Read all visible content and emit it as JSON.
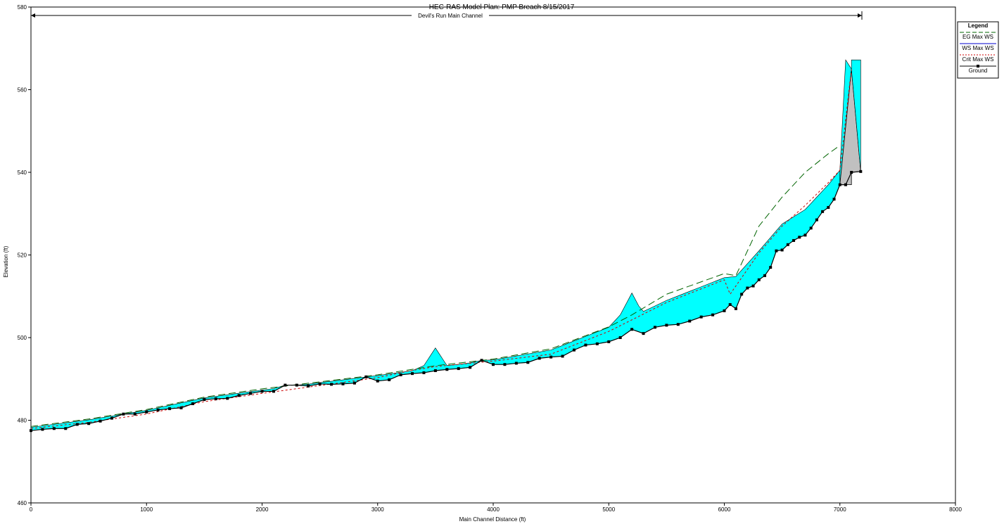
{
  "chart_data": {
    "type": "line",
    "title": "HEC-RAS Model      Plan: PMP Breach     8/15/2017",
    "reach_label": "Devil's Run Main Channel",
    "xlabel": "Main Channel Distance (ft)",
    "ylabel": "Elevation (ft)",
    "xlim": [
      0,
      8000
    ],
    "ylim": [
      460,
      580
    ],
    "x_ticks": [
      0,
      1000,
      2000,
      3000,
      4000,
      5000,
      6000,
      7000,
      8000
    ],
    "y_ticks": [
      460,
      480,
      500,
      520,
      540,
      560,
      580
    ],
    "grid": false,
    "legend_placement": "top-right",
    "legend_title": "Legend",
    "colors": {
      "eg": "#006400",
      "ws": "#0000cc",
      "crit": "#cc0000",
      "ground": "#000000",
      "water_fill": "#00ffff",
      "structure_fill": "#c0c0c0"
    },
    "series": [
      {
        "name": "EG  Max WS",
        "style": "dash",
        "x": [
          0,
          500,
          1000,
          1500,
          2000,
          2500,
          3000,
          3500,
          4000,
          4500,
          5000,
          5200,
          5500,
          6000,
          6100,
          6300,
          6500,
          6700,
          6900,
          7000
        ],
        "y": [
          478.5,
          480.3,
          482.6,
          485.6,
          487.6,
          489.3,
          491.0,
          493.2,
          494.8,
          497.3,
          502.6,
          505.5,
          510.5,
          515.5,
          515.0,
          527.0,
          534.0,
          540.0,
          544.5,
          546.5
        ]
      },
      {
        "name": "WS  Max WS",
        "style": "solid",
        "x": [
          0,
          500,
          1000,
          1500,
          2000,
          2500,
          3000,
          3500,
          4000,
          4500,
          5000,
          5200,
          5500,
          6000,
          6100,
          6300,
          6500,
          6700,
          6900,
          7000,
          7050,
          7100,
          7180
        ],
        "y": [
          478.3,
          480.1,
          482.4,
          485.4,
          487.3,
          489.1,
          490.8,
          492.8,
          494.6,
          497.0,
          502.5,
          505.0,
          509.0,
          514.5,
          514.8,
          521.0,
          527.5,
          531.0,
          537.0,
          540.5,
          567.2,
          567.2,
          567.2
        ]
      },
      {
        "name": "Crit  Max WS",
        "style": "dot",
        "x": [
          0,
          500,
          1000,
          1500,
          2000,
          2500,
          3000,
          3250,
          3500,
          4000,
          4500,
          5000,
          5500,
          6000,
          6050,
          6300,
          6500,
          6700,
          6900,
          7000,
          7100
        ],
        "y": [
          478.0,
          479.5,
          481.5,
          484.5,
          486.5,
          488.4,
          490.3,
          491.8,
          493.0,
          494.3,
          496.0,
          501.5,
          508.5,
          514.0,
          510.5,
          520.5,
          527.0,
          532.0,
          537.5,
          540.5,
          565.0
        ]
      },
      {
        "name": "Ground",
        "style": "solid-marker",
        "x": [
          0,
          100,
          200,
          300,
          400,
          500,
          600,
          700,
          800,
          900,
          1000,
          1100,
          1200,
          1300,
          1400,
          1500,
          1600,
          1700,
          1800,
          1900,
          2000,
          2100,
          2200,
          2300,
          2400,
          2500,
          2600,
          2700,
          2800,
          2900,
          3000,
          3100,
          3200,
          3300,
          3400,
          3500,
          3600,
          3700,
          3800,
          3900,
          4000,
          4100,
          4200,
          4300,
          4400,
          4500,
          4600,
          4700,
          4800,
          4900,
          5000,
          5100,
          5200,
          5300,
          5400,
          5500,
          5600,
          5700,
          5800,
          5900,
          6000,
          6050,
          6100,
          6150,
          6200,
          6250,
          6300,
          6350,
          6400,
          6450,
          6500,
          6550,
          6600,
          6650,
          6700,
          6750,
          6800,
          6850,
          6900,
          6950,
          7000,
          7050,
          7100,
          7180
        ],
        "y": [
          477.5,
          477.8,
          478.0,
          478.0,
          479.0,
          479.2,
          479.8,
          480.5,
          481.5,
          481.5,
          482.0,
          482.5,
          482.8,
          483.0,
          484.0,
          485.0,
          485.2,
          485.3,
          486.0,
          486.5,
          487.0,
          487.0,
          488.5,
          488.5,
          488.3,
          488.8,
          488.7,
          488.8,
          489.0,
          490.5,
          489.5,
          489.8,
          491.0,
          491.3,
          491.5,
          492.0,
          492.3,
          492.5,
          492.8,
          494.5,
          493.5,
          493.5,
          493.8,
          494.0,
          495.0,
          495.3,
          495.5,
          497.0,
          498.2,
          498.5,
          499.0,
          500.0,
          502.0,
          501.0,
          502.5,
          503.0,
          503.2,
          504.0,
          505.0,
          505.5,
          506.5,
          508.0,
          507.0,
          510.5,
          512.0,
          512.5,
          514.0,
          515.0,
          517.0,
          521.0,
          521.2,
          522.5,
          523.5,
          524.3,
          524.8,
          526.5,
          528.5,
          530.5,
          531.5,
          533.5,
          537.0,
          537.0,
          540.0,
          540.2
        ]
      }
    ],
    "water_peaks": [
      {
        "x": 3500,
        "y": 497.5
      },
      {
        "x": 5200,
        "y": 510.8
      }
    ],
    "structure": {
      "x": [
        7000,
        7100,
        7180
      ],
      "top": 567.2
    }
  }
}
